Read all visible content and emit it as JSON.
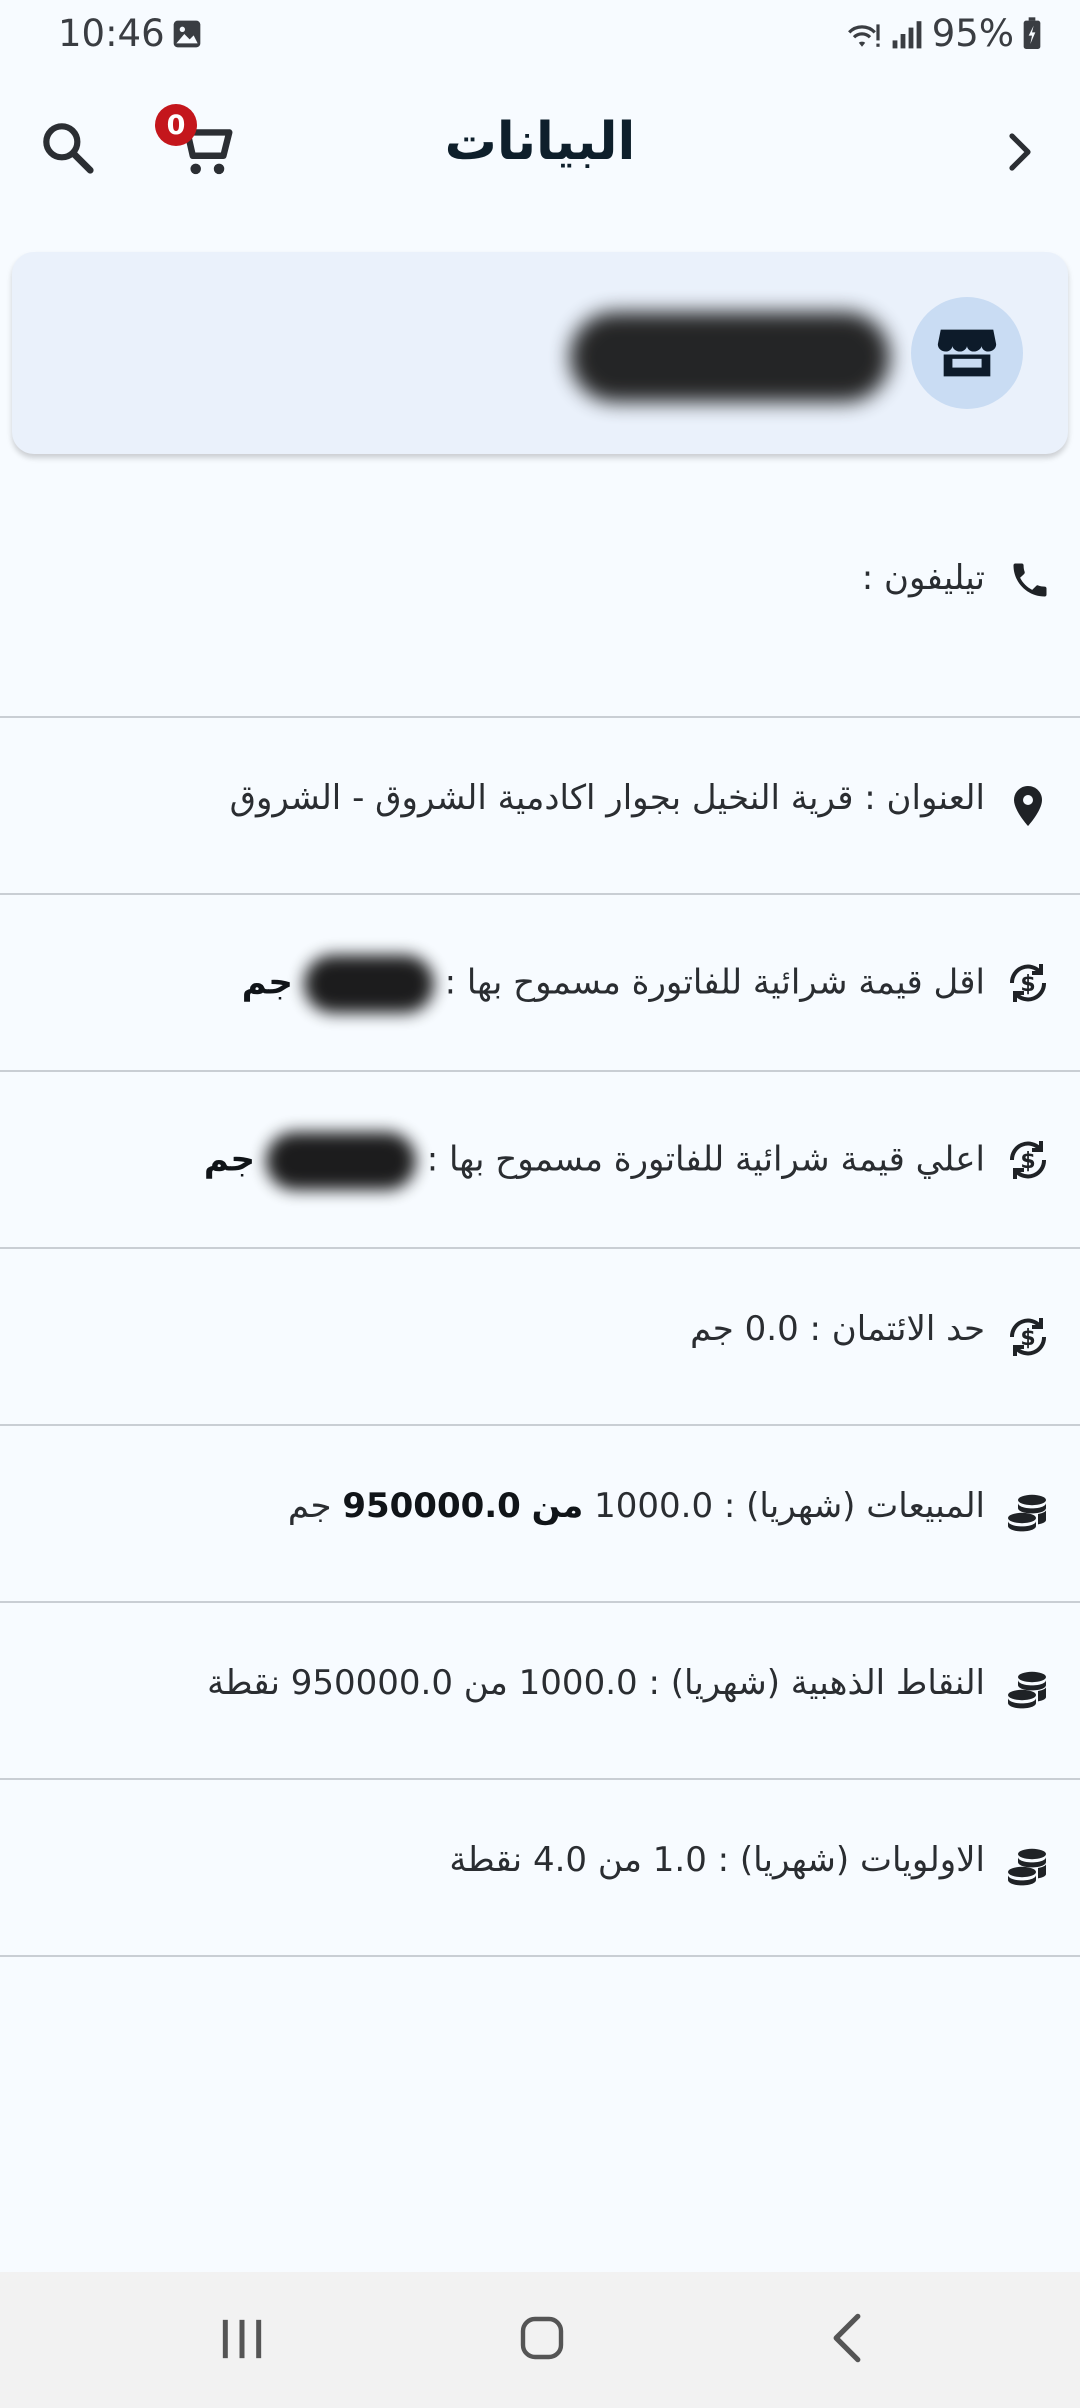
{
  "status_bar": {
    "time": "10:46",
    "battery": "95%"
  },
  "header": {
    "title": "البيانات",
    "cart_count": "0"
  },
  "rows": {
    "phone": {
      "label": "تيليفون :"
    },
    "address": {
      "label": "العنوان :",
      "value": "قرية النخيل بجوار اكادمية الشروق - الشروق"
    },
    "min_invoice": {
      "label": "اقل قيمة شرائية للفاتورة مسموح بها :",
      "unit": "جم"
    },
    "max_invoice": {
      "label": "اعلي قيمة شرائية للفاتورة مسموح بها :",
      "unit": "جم"
    },
    "credit_limit": {
      "label": "حد الائتمان :",
      "value": "0.0 جم"
    },
    "sales": {
      "label": "المبيعات (شهريا) :",
      "value": "1000.0",
      "of": "من",
      "target": "950000.0",
      "unit": "جم"
    },
    "gold_points": {
      "label": "النقاط الذهبية (شهريا) :",
      "value": "1000.0",
      "of": "من",
      "target": "950000.0",
      "unit": "نقطة"
    },
    "priorities": {
      "label": "الاولويات (شهريا) :",
      "value": "1.0",
      "of": "من",
      "target": "4.0",
      "unit": "نقطة"
    }
  },
  "icons": {
    "back": "chevron-right-icon",
    "search": "search-icon",
    "cart": "cart-icon",
    "store": "storefront-icon",
    "phone": "phone-icon",
    "location": "location-pin-icon",
    "money_sync": "currency-exchange-icon",
    "coins": "coins-stack-icon"
  },
  "colors": {
    "badge": "#c4161c",
    "avatar_bg": "#c9dcf3",
    "card_bg": "#eaf1fb"
  }
}
